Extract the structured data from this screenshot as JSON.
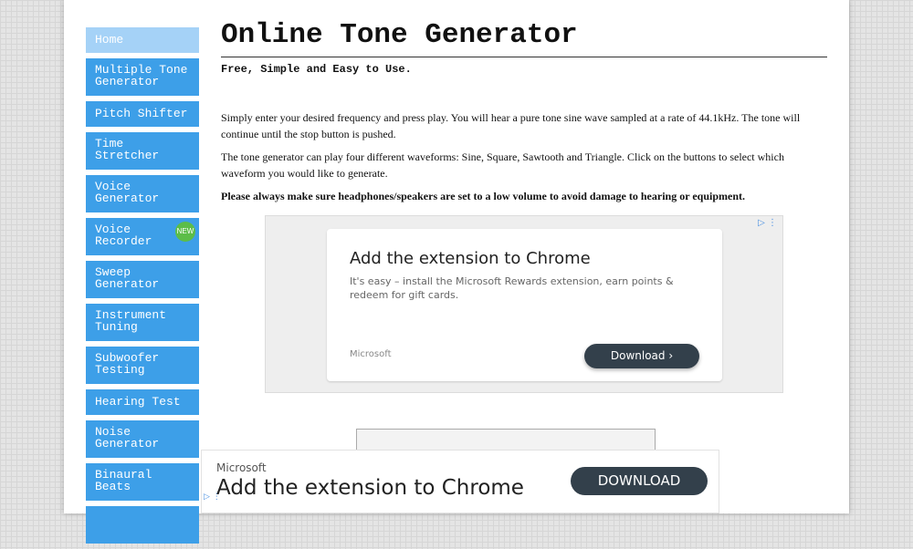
{
  "sidebar": {
    "items": [
      {
        "label": "Home"
      },
      {
        "label": "Multiple Tone Generator"
      },
      {
        "label": "Pitch Shifter"
      },
      {
        "label": "Time Stretcher"
      },
      {
        "label": "Voice Generator"
      },
      {
        "label": "Voice Recorder",
        "badge": "NEW"
      },
      {
        "label": "Sweep Generator"
      },
      {
        "label": "Instrument Tuning"
      },
      {
        "label": "Subwoofer Testing"
      },
      {
        "label": "Hearing Test"
      },
      {
        "label": "Noise Generator"
      },
      {
        "label": "Binaural Beats"
      }
    ]
  },
  "main": {
    "title": "Online Tone Generator",
    "subtitle": "Free, Simple and Easy to Use.",
    "para1": "Simply enter your desired frequency and press play. You will hear a pure tone sine wave sampled at a rate of 44.1kHz. The tone will continue until the stop button is pushed.",
    "para2": "The tone generator can play four different waveforms: Sine, Square, Sawtooth and Triangle. Click on the buttons to select which waveform you would like to generate.",
    "para3": "Please always make sure headphones/speakers are set to a low volume to avoid damage to hearing or equipment."
  },
  "ad": {
    "icons": "▷ ⋮",
    "title": "Add the extension to Chrome",
    "description": "It's easy – install the Microsoft Rewards extension, earn points & redeem for gift cards.",
    "brand": "Microsoft",
    "button": "Download ›"
  },
  "bottom_ad": {
    "brand": "Microsoft",
    "title": "Add the extension to Chrome",
    "button": "DOWNLOAD",
    "adchoice": "▷ ⋮"
  },
  "colors": {
    "nav": "#3d9fe8",
    "nav_active": "#a5d2f7",
    "badge": "#5cbd48",
    "ad_button": "#33404b"
  }
}
